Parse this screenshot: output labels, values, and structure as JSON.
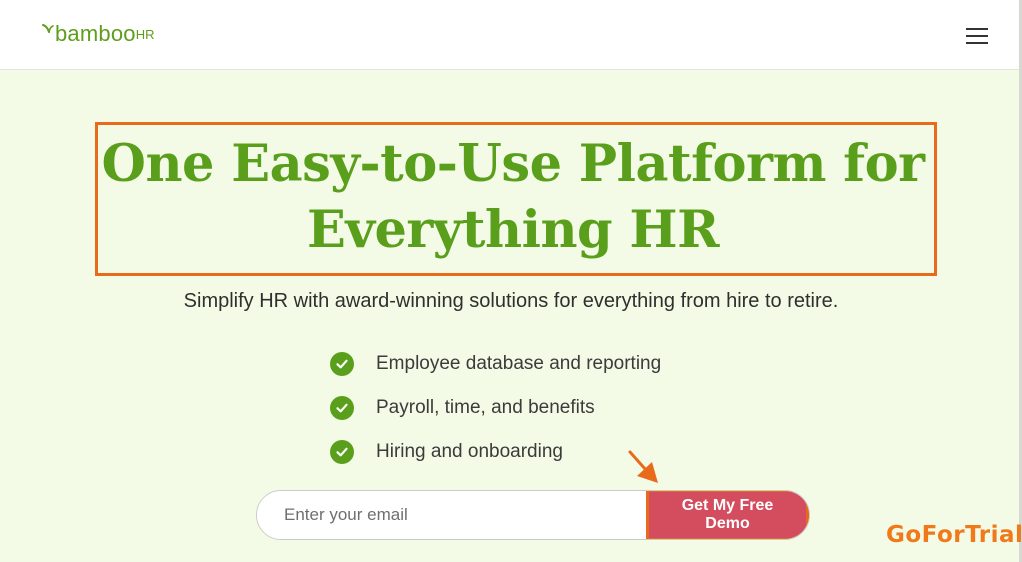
{
  "header": {
    "logo_main": "bamboo",
    "logo_hr": "HR"
  },
  "hero": {
    "title_line1": "One Easy-to-Use Platform for",
    "title_line2": "Everything HR",
    "subtitle": "Simplify HR with award-winning solutions for everything from hire to retire."
  },
  "features": [
    {
      "label": "Employee database and reporting"
    },
    {
      "label": "Payroll, time, and benefits"
    },
    {
      "label": "Hiring and onboarding"
    }
  ],
  "signup": {
    "email_placeholder": "Enter your email",
    "email_value": "",
    "cta_label": "Get My Free Demo"
  },
  "watermark": "GoForTrial",
  "colors": {
    "brand_green": "#5a9f1c",
    "hero_bg": "#f3fbe6",
    "cta_bg": "#d44d5e",
    "highlight_orange": "#ea6a1c"
  },
  "icons": {
    "menu": "hamburger-menu-icon",
    "check": "check-circle-icon",
    "arrow": "pointer-arrow-icon"
  }
}
